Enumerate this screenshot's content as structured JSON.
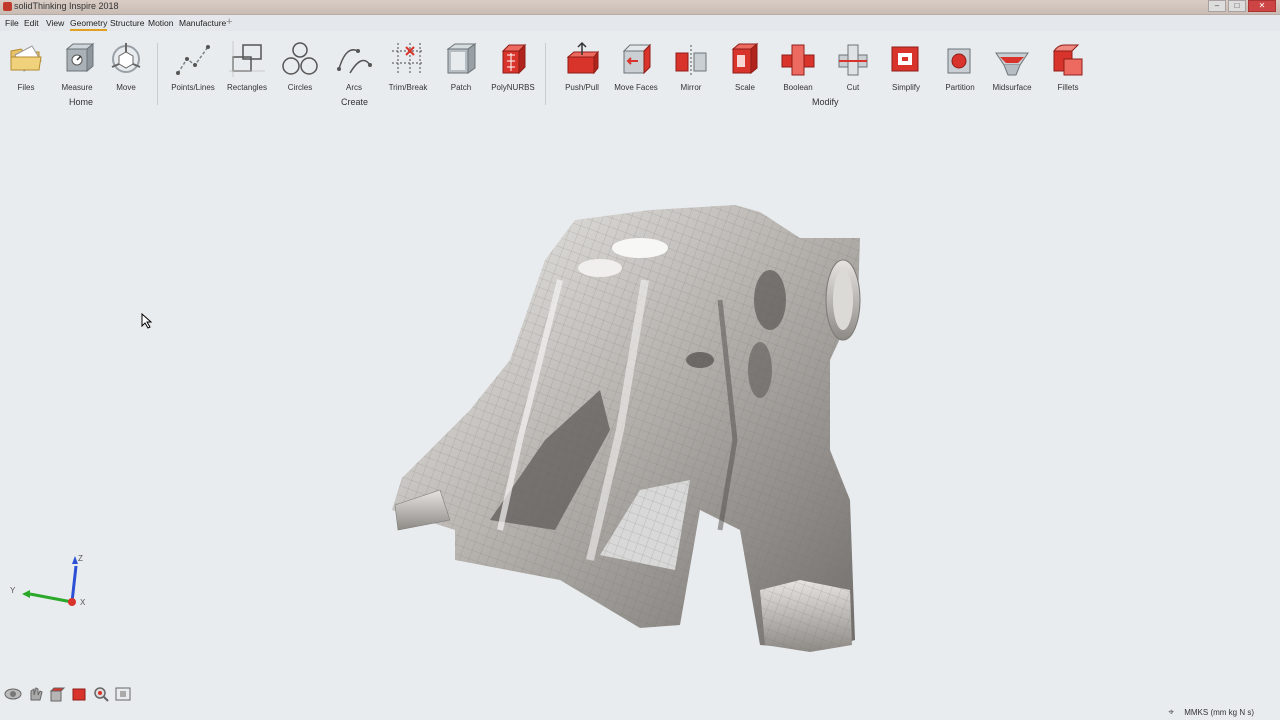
{
  "window": {
    "title": "solidThinking Inspire 2018"
  },
  "menu": {
    "items": [
      "File",
      "Edit",
      "View",
      "Geometry",
      "Structure",
      "Motion",
      "Manufacture"
    ],
    "active": "Geometry",
    "add_tab": "+"
  },
  "ribbon": {
    "home": {
      "group_label": "Home",
      "tools": [
        "Files",
        "Measure",
        "Move"
      ]
    },
    "create": {
      "group_label": "Create",
      "tools": [
        "Points/Lines",
        "Rectangles",
        "Circles",
        "Arcs",
        "Trim/Break",
        "Patch",
        "PolyNURBS"
      ]
    },
    "modify": {
      "group_label": "Modify",
      "tools": [
        "Push/Pull",
        "Move Faces",
        "Mirror",
        "Scale",
        "Boolean",
        "Cut",
        "Simplify",
        "Partition",
        "Midsurface",
        "Fillets"
      ]
    }
  },
  "axes": {
    "z": "Z",
    "y": "Y",
    "x": "X"
  },
  "status": {
    "units": "MMKS (mm kg N s)"
  },
  "colors": {
    "accent": "#e1a020",
    "tool_red": "#d8342c",
    "background": "#e9ecef"
  }
}
